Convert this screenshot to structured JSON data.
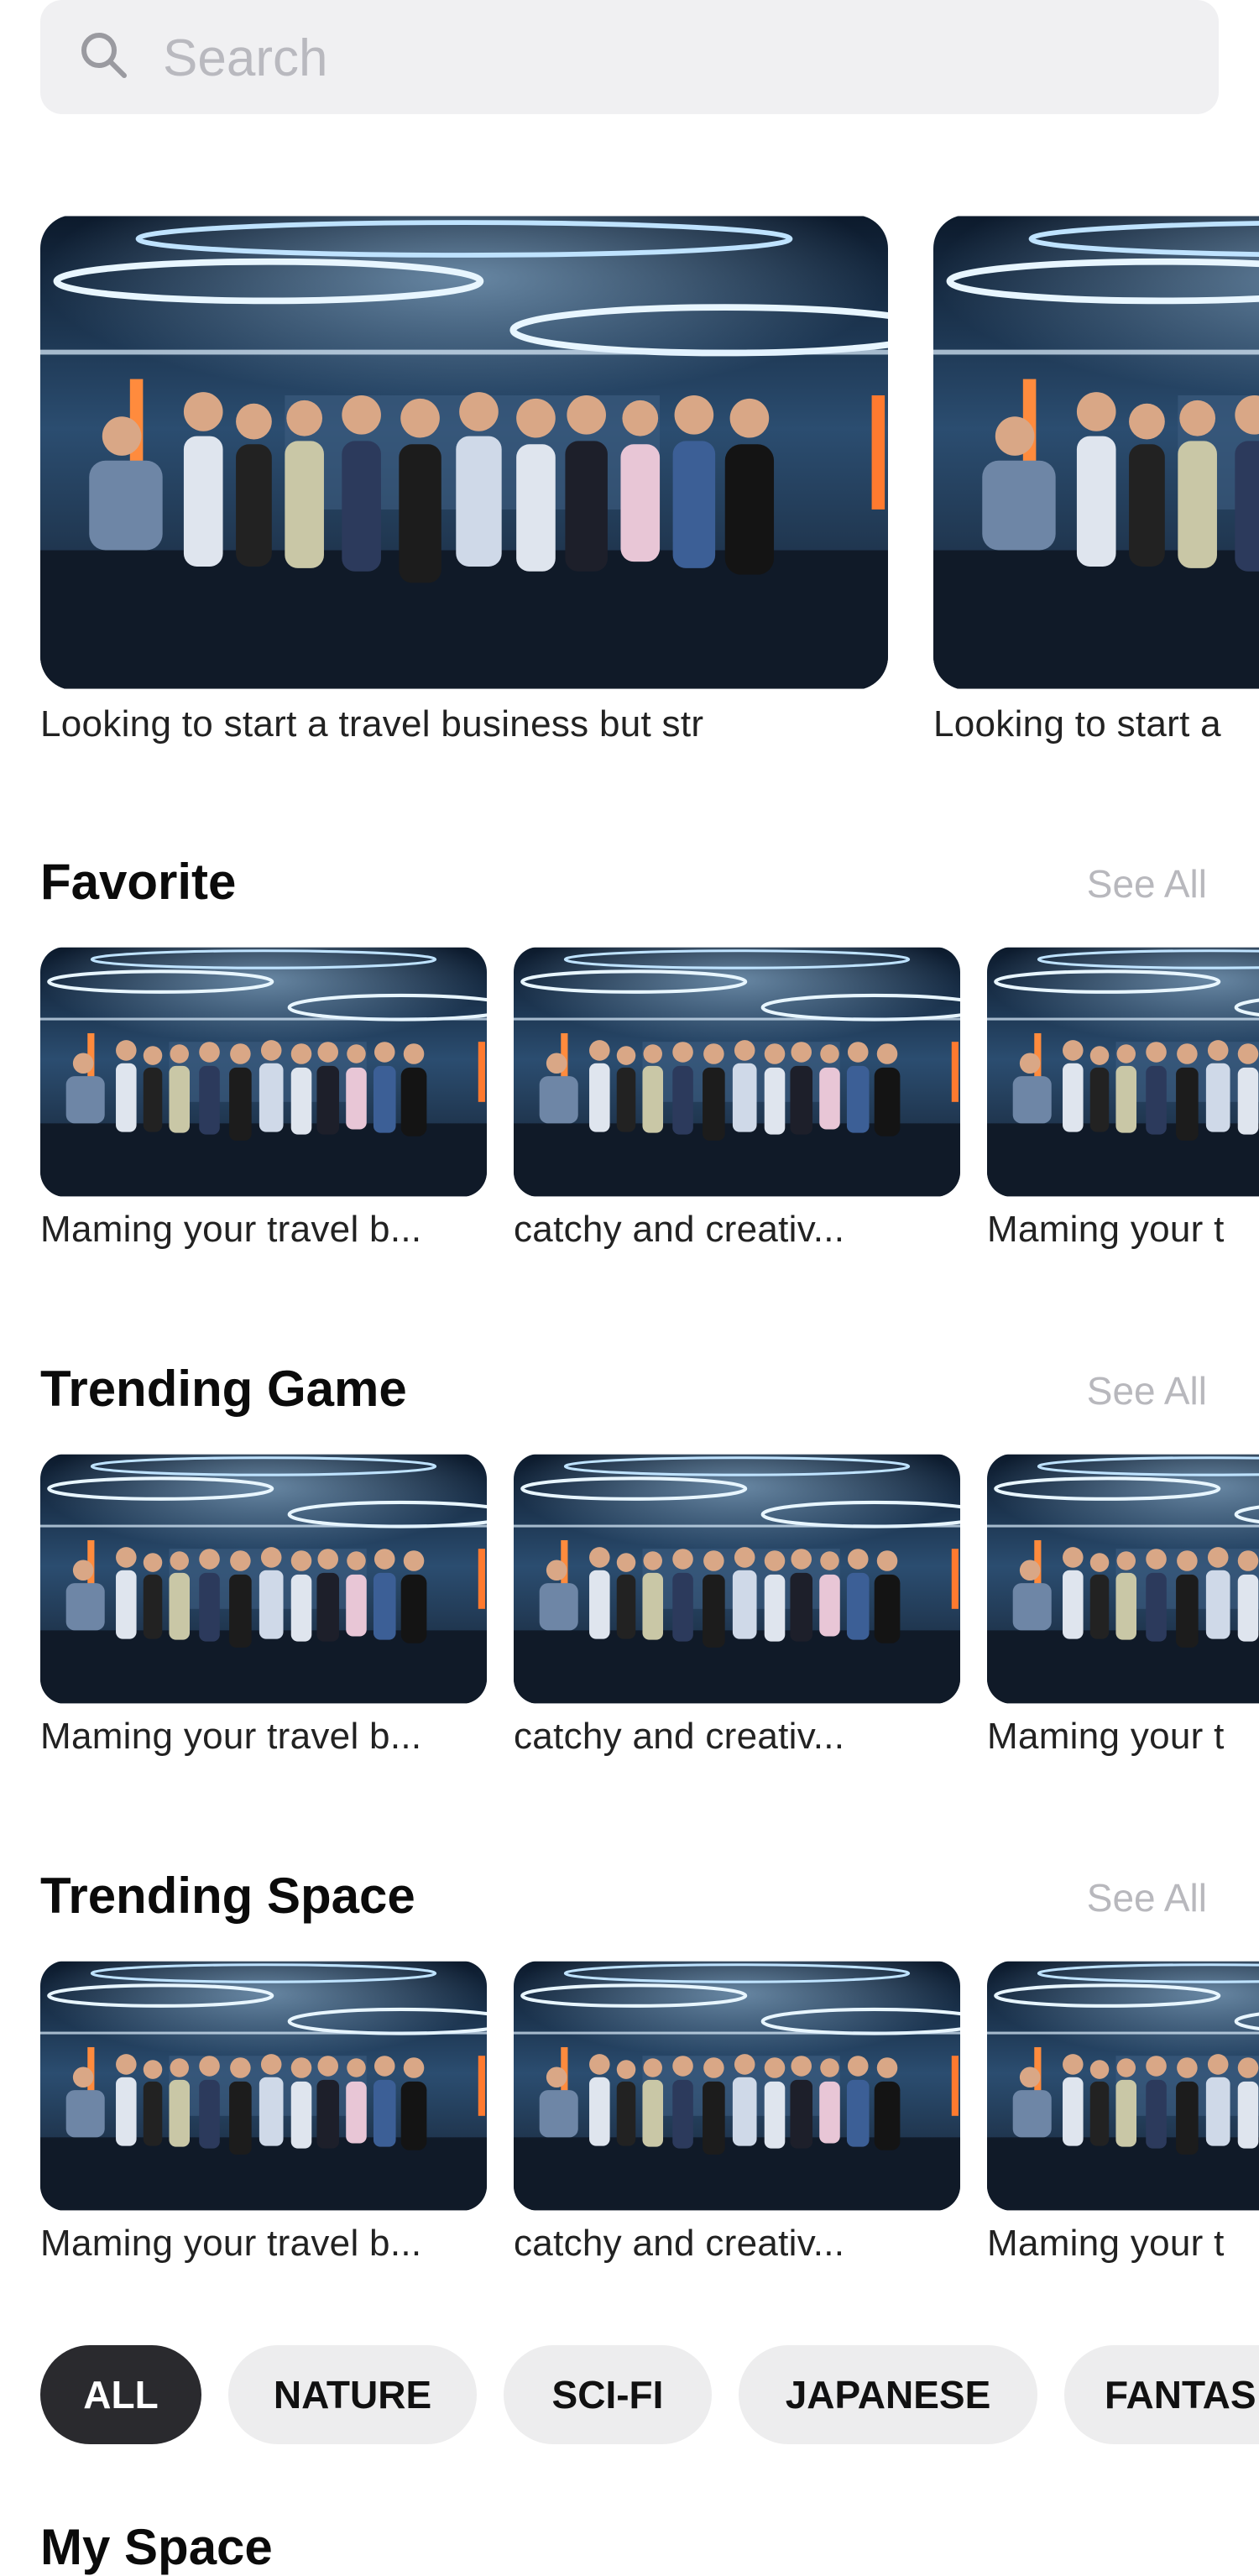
{
  "search": {
    "placeholder": "Search",
    "icon": "search-icon"
  },
  "hero": {
    "items": [
      {
        "caption": "Looking to start a travel business but str"
      },
      {
        "caption": "Looking to start a"
      }
    ]
  },
  "sections": [
    {
      "title": "Favorite",
      "see_all": "See All",
      "items": [
        {
          "caption": "Maming your travel b..."
        },
        {
          "caption": "catchy and creativ..."
        },
        {
          "caption": "Maming your t"
        }
      ]
    },
    {
      "title": "Trending Game",
      "see_all": "See All",
      "items": [
        {
          "caption": "Maming your travel b..."
        },
        {
          "caption": "catchy and creativ..."
        },
        {
          "caption": "Maming your t"
        }
      ]
    },
    {
      "title": "Trending Space",
      "see_all": "See All",
      "items": [
        {
          "caption": "Maming your travel b..."
        },
        {
          "caption": "catchy and creativ..."
        },
        {
          "caption": "Maming your t"
        }
      ]
    }
  ],
  "filters": {
    "items": [
      {
        "label": "ALL",
        "active": true
      },
      {
        "label": "NATURE",
        "active": false
      },
      {
        "label": "SCI-FI",
        "active": false
      },
      {
        "label": "JAPANESE",
        "active": false
      },
      {
        "label": "FANTAS",
        "active": false
      }
    ]
  },
  "next_section": {
    "title": "My Space"
  },
  "colors": {
    "chip_active": "#2a2a2e",
    "chip": "#ededee",
    "search_bg": "#f0f0f2",
    "muted": "#b8b8bd"
  }
}
